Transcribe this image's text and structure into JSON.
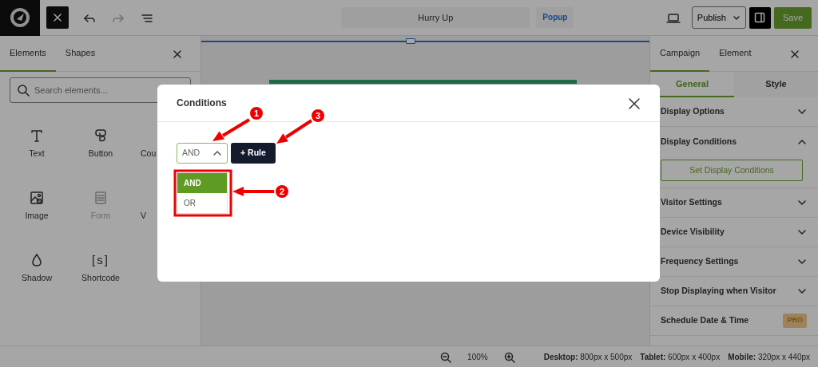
{
  "header": {
    "history": [
      {
        "kind": "undo",
        "disabled": false
      },
      {
        "kind": "redo",
        "disabled": true
      }
    ],
    "title": "Hurry Up",
    "type_tag": "Popup",
    "publish": "Publish",
    "save": "Save"
  },
  "left_panel": {
    "tabs": [
      {
        "label": "Elements",
        "selected": true
      },
      {
        "label": "Shapes",
        "selected": false
      }
    ],
    "search": {
      "placeholder": "Search elements..."
    },
    "elements": [
      {
        "label": "Text",
        "kind": "text",
        "disabled": false
      },
      {
        "label": "Button",
        "kind": "button",
        "disabled": false
      },
      {
        "label": "Cou",
        "kind": "countdown",
        "disabled": false
      },
      {
        "label": "Image",
        "kind": "image",
        "disabled": false
      },
      {
        "label": "Form",
        "kind": "form",
        "disabled": true
      },
      {
        "label": "V",
        "kind": "video",
        "disabled": false
      },
      {
        "label": "Shadow",
        "kind": "shadow",
        "disabled": false
      },
      {
        "label": "Shortcode",
        "kind": "shortcode",
        "glyph": "[s]",
        "disabled": false
      }
    ]
  },
  "right_panel": {
    "tabs": [
      {
        "label": "Campaign",
        "selected": true
      },
      {
        "label": "Element",
        "selected": false
      }
    ],
    "subtabs": [
      {
        "label": "General",
        "selected": true
      },
      {
        "label": "Style",
        "selected": false
      }
    ],
    "sections": [
      {
        "title": "Display Options",
        "expanded": false
      },
      {
        "title": "Display Conditions",
        "expanded": true,
        "button": "Set Display Conditions"
      },
      {
        "title": "Visitor Settings",
        "expanded": false
      },
      {
        "title": "Device Visibility",
        "expanded": false
      },
      {
        "title": "Frequency Settings",
        "expanded": false
      },
      {
        "title": "Stop Displaying when Visitor",
        "expanded": false
      },
      {
        "title": "Schedule Date & Time",
        "expanded": false,
        "badge": "PRO"
      }
    ]
  },
  "status_bar": {
    "zoom": "100%",
    "sizes": [
      "**Desktop:** 800px x 500px",
      "**Tablet:** 600px x 400px",
      "**Mobile:** 320px x 440px"
    ]
  },
  "modal": {
    "title": "Conditions",
    "select": {
      "value": "AND",
      "expanded": true
    },
    "add_button": "+ Rule",
    "options": [
      {
        "label": "AND",
        "selected": true
      },
      {
        "label": "OR",
        "selected": false
      }
    ]
  },
  "annotations": [
    {
      "number": "1"
    },
    {
      "number": "2"
    },
    {
      "number": "3"
    }
  ]
}
